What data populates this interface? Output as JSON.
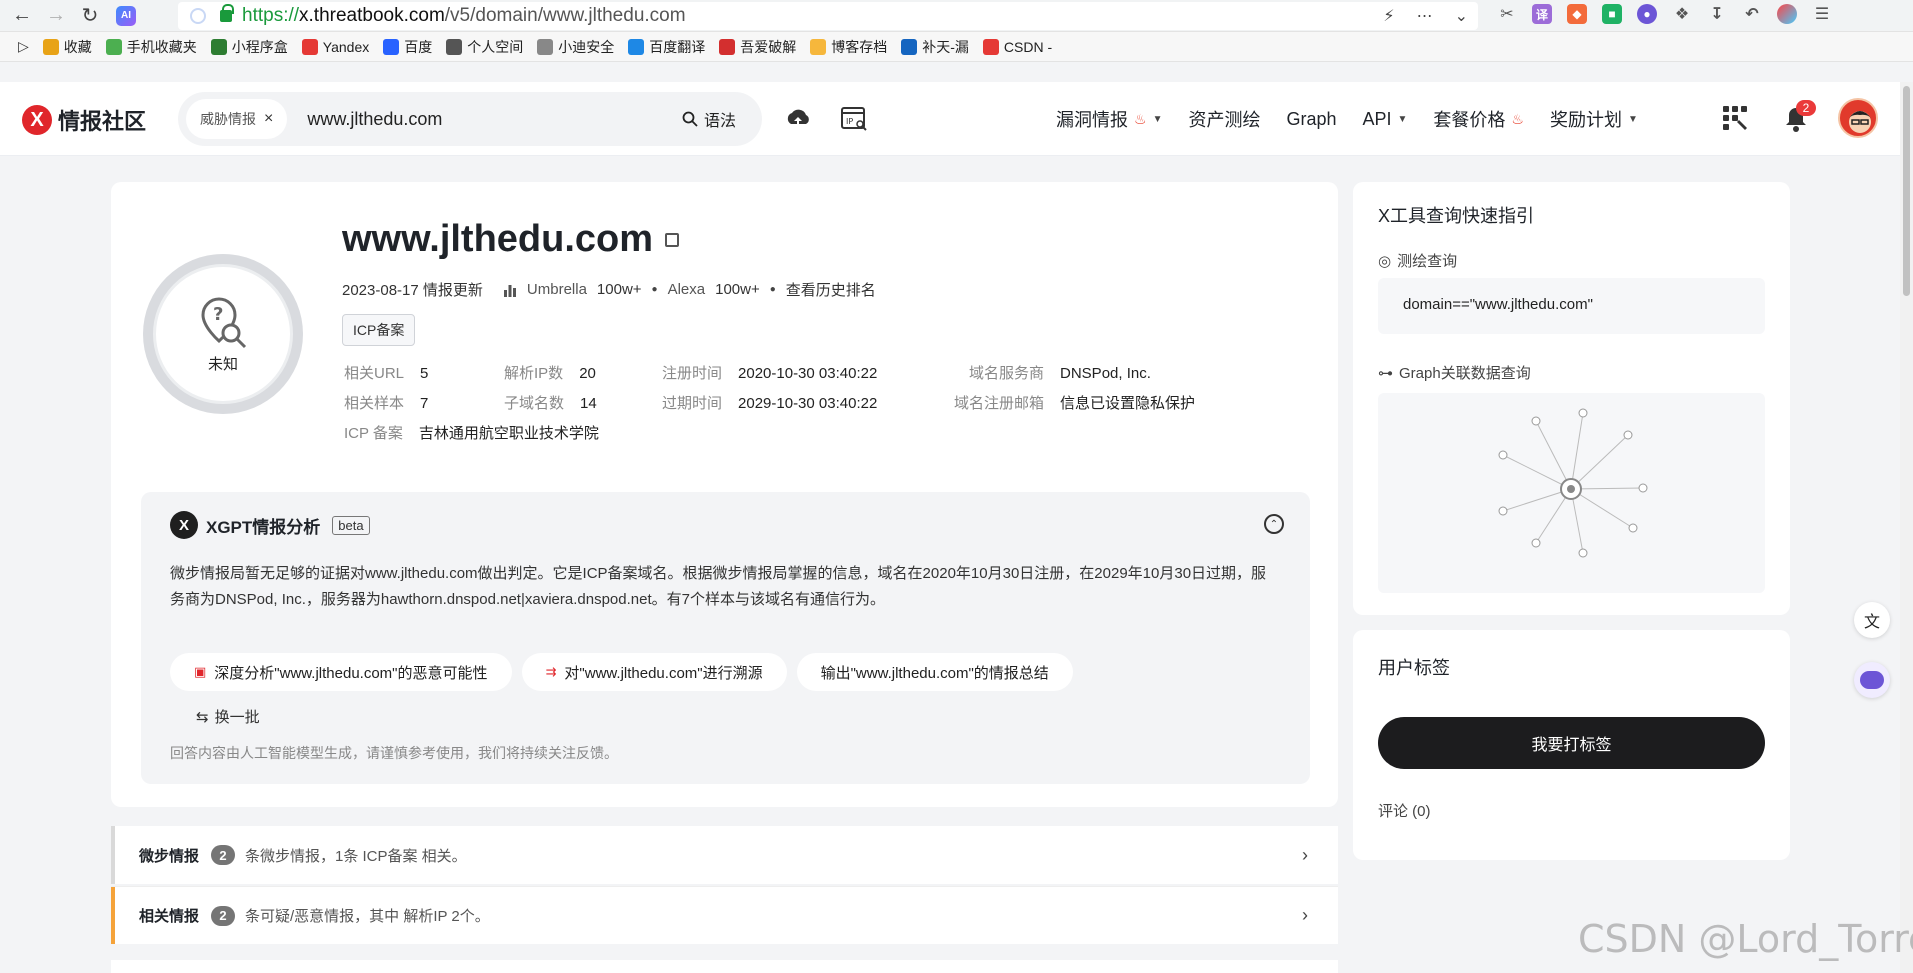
{
  "browser": {
    "url_scheme": "https://",
    "url_host": "x.threatbook.com",
    "url_path": "/v5/domain/www.jlthedu.com",
    "bookmarks": [
      {
        "label": "收藏",
        "color": "#e8a317"
      },
      {
        "label": "手机收藏夹",
        "color": "#4caf50"
      },
      {
        "label": "小程序盒",
        "color": "#2e7d32"
      },
      {
        "label": "Yandex",
        "color": "#e53935"
      },
      {
        "label": "百度",
        "color": "#2962ff"
      },
      {
        "label": "个人空间",
        "color": "#555555"
      },
      {
        "label": "小迪安全",
        "color": "#888888"
      },
      {
        "label": "百度翻译",
        "color": "#1e88e5"
      },
      {
        "label": "吾爱破解",
        "color": "#d32f2f"
      },
      {
        "label": "博客存档",
        "color": "#f6b73c"
      },
      {
        "label": "补天-漏",
        "color": "#1565c0"
      },
      {
        "label": "CSDN -",
        "color": "#e53935"
      }
    ]
  },
  "header": {
    "logo_text": "情报社区",
    "search_tag": "威胁情报",
    "search_value": "www.jlthedu.com",
    "search_syntax": "语法",
    "nav": [
      {
        "label": "漏洞情报",
        "fire": true,
        "caret": true
      },
      {
        "label": "资产测绘",
        "fire": false,
        "caret": false
      },
      {
        "label": "Graph",
        "fire": false,
        "caret": false
      },
      {
        "label": "API",
        "fire": false,
        "caret": true
      },
      {
        "label": "套餐价格",
        "fire": true,
        "caret": false
      },
      {
        "label": "奖励计划",
        "fire": false,
        "caret": true
      }
    ],
    "notification_count": "2"
  },
  "domain": {
    "name": "www.jlthedu.com",
    "risk_label": "未知",
    "update_line": "2023-08-17 情报更新",
    "umbrella_label": "Umbrella",
    "umbrella_rank": "100w+",
    "alexa_label": "Alexa",
    "alexa_rank": "100w+",
    "history_link": "查看历史排名",
    "icp_chip": "ICP备案",
    "info": {
      "related_url_k": "相关URL",
      "related_url_v": "5",
      "resolve_ip_k": "解析IP数",
      "resolve_ip_v": "20",
      "reg_time_k": "注册时间",
      "reg_time_v": "2020-10-30 03:40:22",
      "dns_provider_k": "域名服务商",
      "dns_provider_v": "DNSPod, Inc.",
      "related_sample_k": "相关样本",
      "related_sample_v": "7",
      "subdomain_k": "子域名数",
      "subdomain_v": "14",
      "expire_time_k": "过期时间",
      "expire_time_v": "2029-10-30 03:40:22",
      "reg_email_k": "域名注册邮箱",
      "reg_email_v": "信息已设置隐私保护",
      "icp_k": "ICP 备案",
      "icp_v": "吉林通用航空职业技术学院"
    }
  },
  "xgpt": {
    "title": "XGPT情报分析",
    "beta": "beta",
    "body": "微步情报局暂无足够的证据对www.jlthedu.com做出判定。它是ICP备案域名。根据微步情报局掌握的信息，域名在2020年10月30日注册，在2029年10月30日过期，服务商为DNSPod, Inc.，服务器为hawthorn.dnspod.net|xaviera.dnspod.net。有7个样本与该域名有通信行为。",
    "chips": [
      "深度分析\"www.jlthedu.com\"的恶意可能性",
      "对\"www.jlthedu.com\"进行溯源",
      "输出\"www.jlthedu.com\"的情报总结"
    ],
    "refresh": "换一批",
    "disclaimer": "回答内容由人工智能模型生成，请谨慎参考使用，我们将持续关注反馈。"
  },
  "rows": [
    {
      "title": "微步情报",
      "count": "2",
      "desc": "条微步情报，1条 ICP备案 相关。",
      "accent": "#d9d9d9"
    },
    {
      "title": "相关情报",
      "count": "2",
      "desc": "条可疑/恶意情报，其中 解析IP 2个。",
      "accent": "#f5a33a"
    }
  ],
  "side": {
    "guide_title": "X工具查询快速指引",
    "mapping_label": "测绘查询",
    "mapping_query": "domain==\"www.jlthedu.com\"",
    "graph_label": "Graph关联数据查询",
    "user_tags_title": "用户标签",
    "tag_button": "我要打标签",
    "comments": "评论 (0)"
  },
  "watermark": "CSDN @Lord_Torres"
}
